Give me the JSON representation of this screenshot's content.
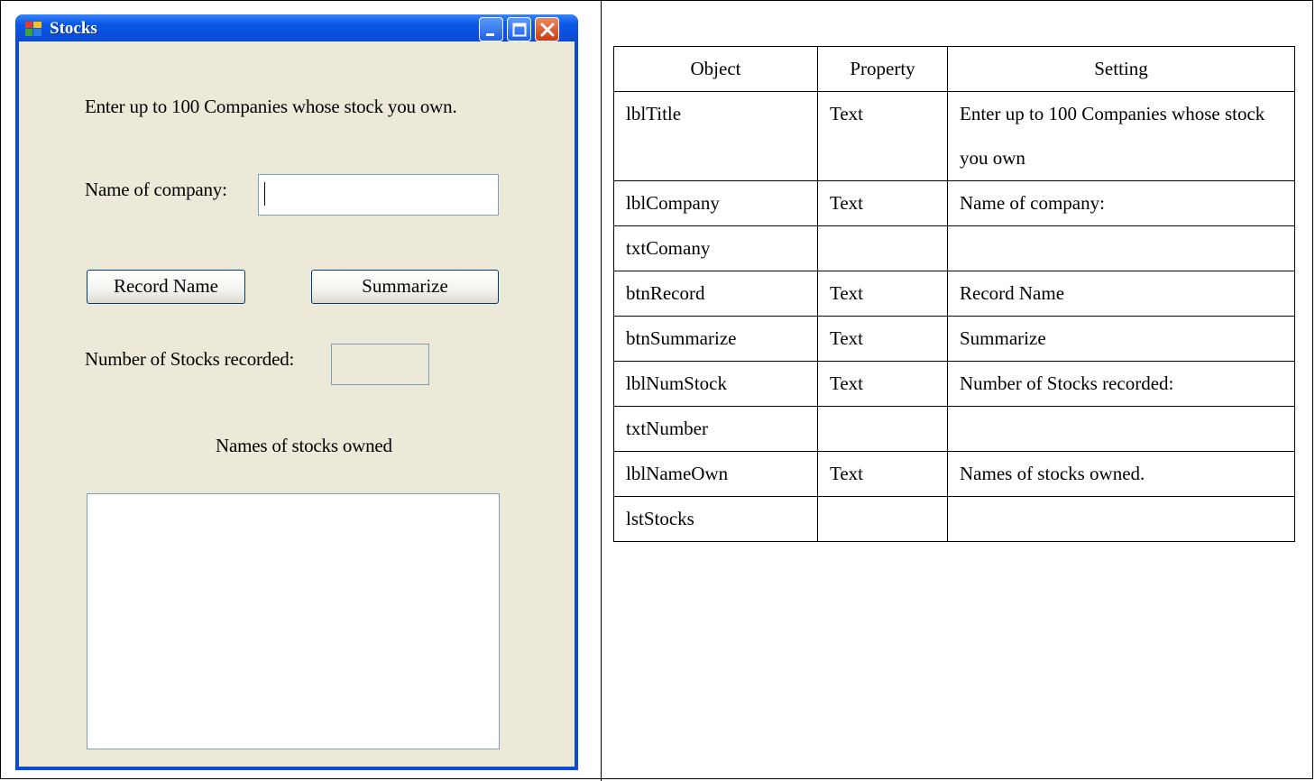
{
  "window": {
    "title": "Stocks",
    "title_label": "Enter up to 100 Companies whose stock you own.",
    "company_label": "Name of company:",
    "company_value": "",
    "record_button": "Record Name",
    "summarize_button": "Summarize",
    "count_label": "Number of Stocks recorded:",
    "count_value": "",
    "stocks_label": "Names of stocks owned",
    "stocks_items": []
  },
  "table": {
    "headers": [
      "Object",
      "Property",
      "Setting"
    ],
    "rows": [
      [
        "lblTitle",
        "Text",
        "Enter up to 100 Companies whose stock you own"
      ],
      [
        "lblCompany",
        "Text",
        "Name of company:"
      ],
      [
        "txtComany",
        "",
        ""
      ],
      [
        "btnRecord",
        "Text",
        "Record Name"
      ],
      [
        "btnSummarize",
        "Text",
        "Summarize"
      ],
      [
        "lblNumStock",
        "Text",
        "Number of Stocks recorded:"
      ],
      [
        "txtNumber",
        "",
        ""
      ],
      [
        "lblNameOwn",
        "Text",
        "Names of stocks owned."
      ],
      [
        "lstStocks",
        "",
        ""
      ]
    ]
  },
  "colors": {
    "titlebar": "#0a59e8",
    "client": "#ece9d8",
    "input_border": "#7f9db9"
  }
}
